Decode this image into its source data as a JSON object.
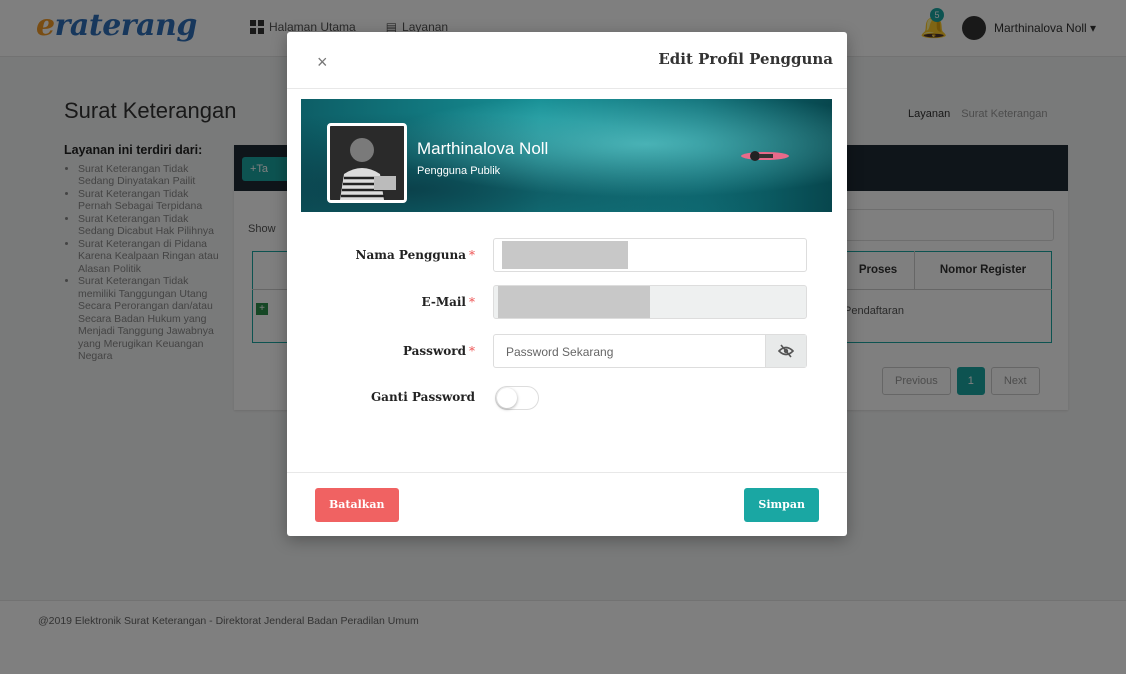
{
  "app": {
    "logo_first": "e",
    "logo_rest": "raterang",
    "nav": [
      {
        "label": "Halaman Utama",
        "icon": "grid-icon"
      },
      {
        "label": "Layanan",
        "icon": "document-icon"
      }
    ],
    "notification_count": "5",
    "user_name": "Marthinalova Noll ▾"
  },
  "page": {
    "title": "Surat Keterangan",
    "breadcrumb": [
      "Layanan",
      "Surat Keterangan"
    ],
    "sidebar_heading": "Layanan ini terdiri dari:",
    "sidebar_items": [
      "Surat Keterangan Tidak Sedang Dinyatakan Pailit",
      "Surat Keterangan Tidak Pernah Sebagai Terpidana",
      "Surat Keterangan Tidak Sedang Dicabut Hak Pilihnya",
      "Surat Keterangan di Pidana Karena Kealpaan Ringan atau Alasan Politik",
      "Surat Keterangan Tidak memiliki Tanggungan Utang Secara Perorangan dan/atau Secara Badan Hukum yang Menjadi Tanggung Jawabnya yang Merugikan Keuangan Negara"
    ],
    "add_button": "+Ta",
    "show_label": "Show",
    "table": {
      "headers": [
        "Proses",
        "Nomor Register"
      ],
      "row_proses": "Pendaftaran",
      "row_expand": "+"
    },
    "pagination": {
      "previous": "Previous",
      "current": "1",
      "next": "Next"
    },
    "footer": "@2019 Elektronik Surat Keterangan - Direktorat Jenderal Badan Peradilan Umum"
  },
  "modal": {
    "title": "Edit Profil Pengguna",
    "close": "×",
    "profile_name": "Marthinalova Noll",
    "profile_role": "Pengguna Publik",
    "fields": {
      "username_label": "Nama Pengguna",
      "email_label": "E-Mail",
      "password_label": "Password",
      "password_placeholder": "Password Sekarang",
      "change_password_label": "Ganti Password",
      "required_mark": "*",
      "change_password_on": false
    },
    "cancel_button": "Batalkan",
    "save_button": "Simpan"
  },
  "colors": {
    "accent": "#1aa7a3",
    "danger": "#f06262",
    "logo_blue": "#2f6fb8",
    "logo_orange": "#f29a26"
  }
}
